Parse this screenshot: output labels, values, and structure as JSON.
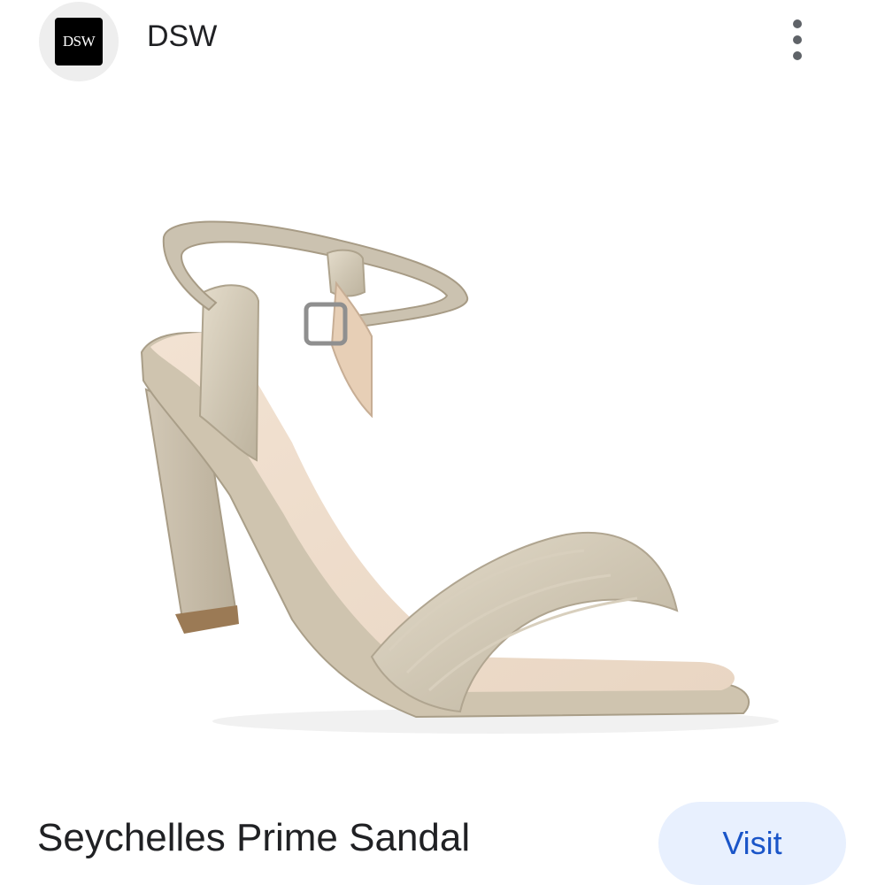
{
  "header": {
    "logo_text": "DSW",
    "source_name": "DSW",
    "more_icon": "more-vert-icon"
  },
  "product": {
    "image_icon": "sandal-image",
    "title": "Seychelles Prime Sandal"
  },
  "actions": {
    "visit_label": "Visit"
  },
  "colors": {
    "visit_bg": "#e8f0fe",
    "visit_text": "#1a55c8",
    "title_text": "#202124"
  }
}
